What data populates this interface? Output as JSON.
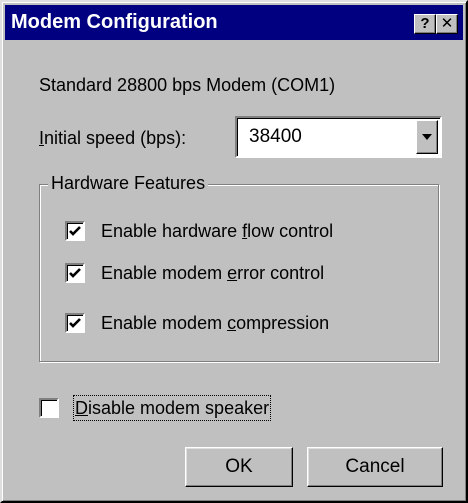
{
  "window": {
    "title": "Modem Configuration",
    "help_button": "?",
    "close_button": "✕"
  },
  "modem_name": "Standard 28800 bps Modem (COM1)",
  "speed": {
    "label_underlined": "I",
    "label_rest": "nitial speed (bps):",
    "value": "38400"
  },
  "hardware": {
    "title": "Hardware Features",
    "items": [
      {
        "pre": "Enable hardware ",
        "ul": "f",
        "post": "low control",
        "checked": true
      },
      {
        "pre": "Enable modem ",
        "ul": "e",
        "post": "rror control",
        "checked": true
      },
      {
        "pre": "Enable modem ",
        "ul": "c",
        "post": "ompression",
        "checked": true
      }
    ]
  },
  "speaker": {
    "pre": "",
    "ul": "D",
    "post": "isable modem speaker",
    "checked": false
  },
  "buttons": {
    "ok": "OK",
    "cancel": "Cancel"
  },
  "colors": {
    "titlebar": "#000080",
    "face": "#c0c0c0"
  }
}
